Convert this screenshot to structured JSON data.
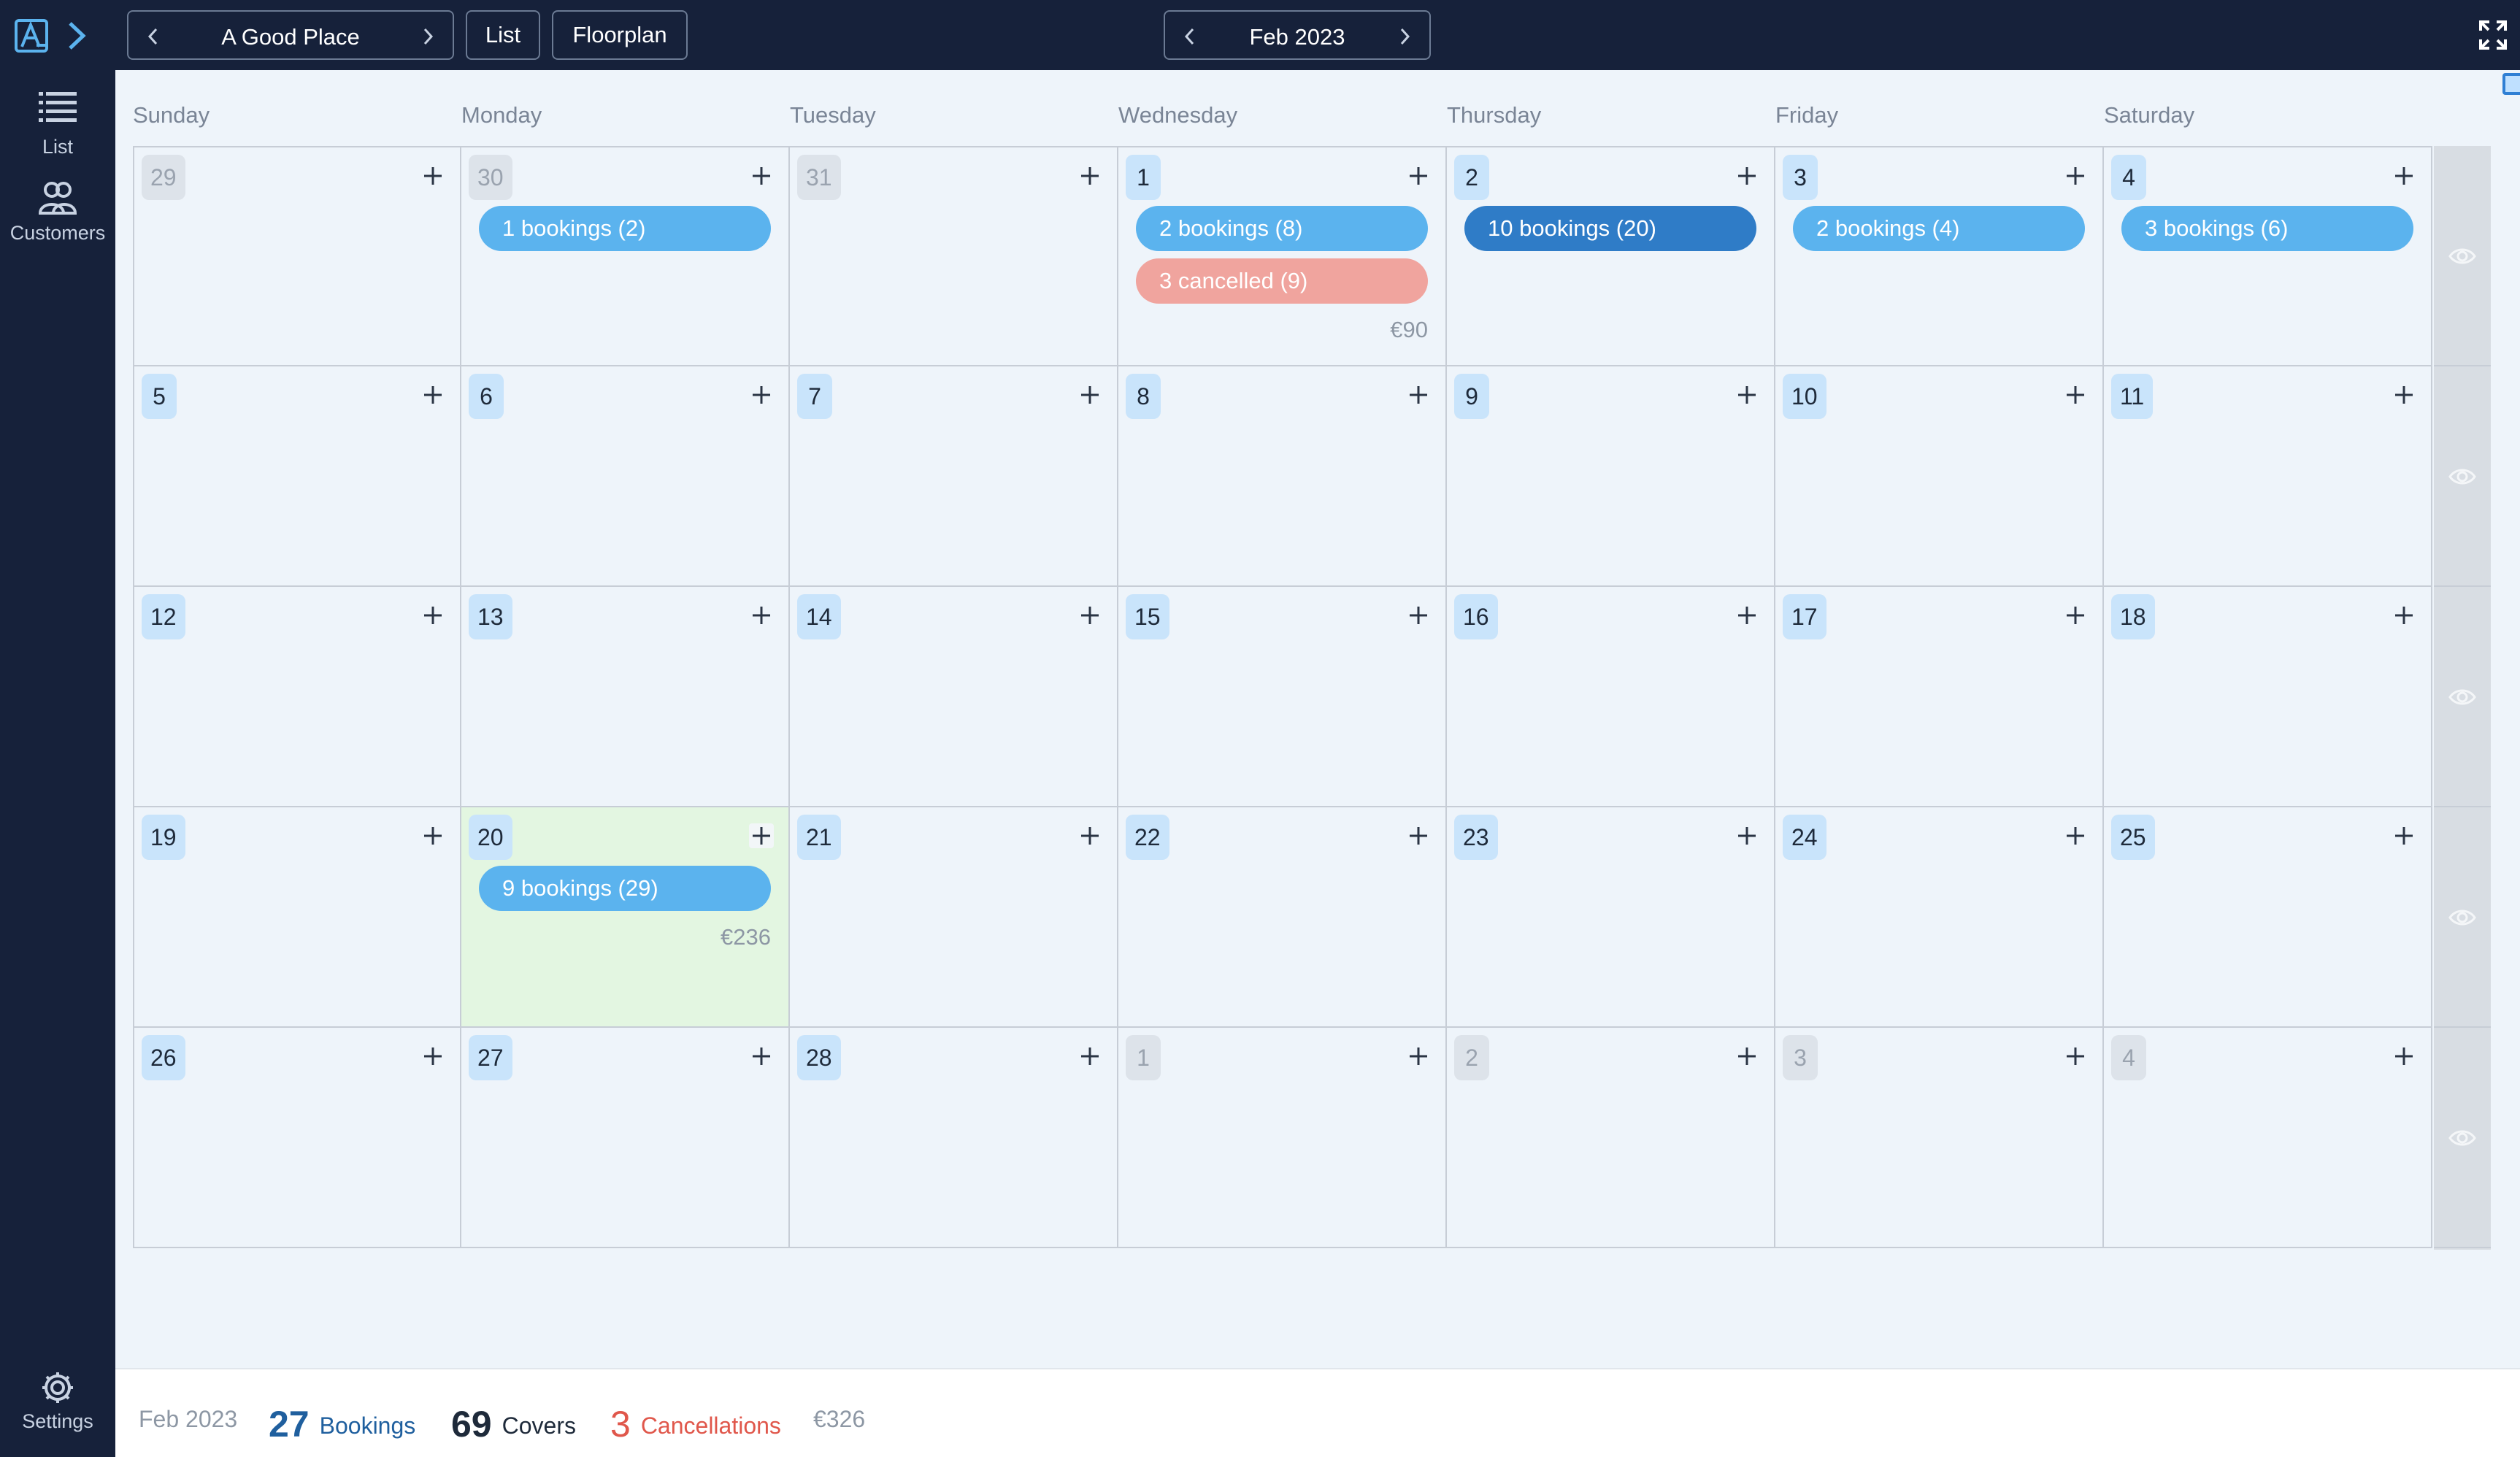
{
  "topbar": {
    "venue": "A Good Place",
    "list_label": "List",
    "floorplan_label": "Floorplan",
    "month": "Feb 2023"
  },
  "sidebar": {
    "items": [
      {
        "label": "List",
        "icon": "list-icon"
      },
      {
        "label": "Customers",
        "icon": "customers-icon"
      }
    ],
    "settings_label": "Settings"
  },
  "colors": {
    "topbar_bg": "#16213a",
    "booking_pill": "#5bb3ee",
    "booking_pill_busy": "#2f7cc7",
    "cancelled_pill": "#f0a49e",
    "today_bg": "#e3f6e1",
    "day_badge": "#c9e4fb"
  },
  "calendar": {
    "weekdays": [
      "Sunday",
      "Monday",
      "Tuesday",
      "Wednesday",
      "Thursday",
      "Friday",
      "Saturday"
    ],
    "weeks": [
      [
        {
          "day": "29",
          "other": true
        },
        {
          "day": "30",
          "other": true,
          "bookings": "1 bookings (2)"
        },
        {
          "day": "31",
          "other": true
        },
        {
          "day": "1",
          "bookings": "2 bookings (8)",
          "cancelled": "3 cancelled (9)",
          "amount": "€90"
        },
        {
          "day": "2",
          "bookings": "10 bookings (20)",
          "busy": true
        },
        {
          "day": "3",
          "bookings": "2 bookings (4)"
        },
        {
          "day": "4",
          "bookings": "3 bookings (6)"
        }
      ],
      [
        {
          "day": "5"
        },
        {
          "day": "6"
        },
        {
          "day": "7"
        },
        {
          "day": "8"
        },
        {
          "day": "9"
        },
        {
          "day": "10"
        },
        {
          "day": "11"
        }
      ],
      [
        {
          "day": "12"
        },
        {
          "day": "13"
        },
        {
          "day": "14"
        },
        {
          "day": "15"
        },
        {
          "day": "16"
        },
        {
          "day": "17"
        },
        {
          "day": "18"
        }
      ],
      [
        {
          "day": "19"
        },
        {
          "day": "20",
          "today": true,
          "bookings": "9 bookings (29)",
          "amount": "€236"
        },
        {
          "day": "21"
        },
        {
          "day": "22"
        },
        {
          "day": "23"
        },
        {
          "day": "24"
        },
        {
          "day": "25"
        }
      ],
      [
        {
          "day": "26"
        },
        {
          "day": "27"
        },
        {
          "day": "28"
        },
        {
          "day": "1",
          "other": true
        },
        {
          "day": "2",
          "other": true
        },
        {
          "day": "3",
          "other": true
        },
        {
          "day": "4",
          "other": true
        }
      ]
    ]
  },
  "footer": {
    "month": "Feb 2023",
    "bookings_count": "27",
    "bookings_label": "Bookings",
    "covers_count": "69",
    "covers_label": "Covers",
    "cancellations_count": "3",
    "cancellations_label": "Cancellations",
    "revenue": "€326"
  }
}
